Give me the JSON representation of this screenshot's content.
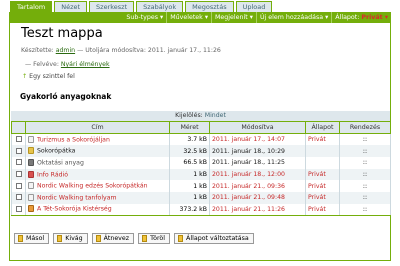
{
  "tabs": [
    "Tartalom",
    "Nézet",
    "Szerkeszt",
    "Szabályok",
    "Megosztás",
    "Upload"
  ],
  "actions": {
    "subtypes": "Sub-types ▾",
    "muveletek": "Műveletek ▾",
    "megjelenit": "Megjelenít ▾",
    "uj_elem": "Új elem hozzáadása ▾",
    "allapot_label": "Állapot:",
    "allapot_value": "Privát ▾"
  },
  "page": {
    "title": "Teszt mappa",
    "byline_prefix": "Készítette:",
    "author": "admin",
    "byline_suffix": "— Utoljára módosítva: 2011. január 17., 11:26",
    "attached_prefix": "— Felvéve:",
    "attached_link": "Nyári élmények",
    "up_arrow": "↑",
    "up_label": "Egy szinttel fel",
    "description": "Gyakorló anyagoknak"
  },
  "table": {
    "selection_label": "Kijelölés:",
    "selection_link": "Mindet",
    "headers": [
      "Cím",
      "Méret",
      "Módosítva",
      "Állapot",
      "Rendezés"
    ],
    "rows": [
      {
        "icon": "page-icon",
        "title": "Turizmus a Sokorójáljan",
        "size": "3.7 kB",
        "modified": "2011. január 17., 14:07",
        "state": "Privát",
        "order": "::"
      },
      {
        "icon": "folder-icon",
        "title": "Sokorópátka",
        "size": "32.5 kB",
        "modified": "2011. január 18., 10:29",
        "state": "",
        "order": "::"
      },
      {
        "icon": "link-icon",
        "title": "Oktatási anyag",
        "size": "66.5 kB",
        "modified": "2011. január 18., 11:25",
        "state": "",
        "order": "::"
      },
      {
        "icon": "news-icon",
        "title": "Info Rádió",
        "size": "1 kB",
        "modified": "2011. január 18., 12:00",
        "state": "Privát",
        "order": "::"
      },
      {
        "icon": "page-icon",
        "title": "Nordic Walking edzés Sokorópátkán",
        "size": "1 kB",
        "modified": "2011. január 21., 09:36",
        "state": "Privát",
        "order": "::"
      },
      {
        "icon": "page-icon",
        "title": "Nordic Walking tanfolyam",
        "size": "1 kB",
        "modified": "2011. január 21., 09:48",
        "state": "Privát",
        "order": "::"
      },
      {
        "icon": "file-icon",
        "title": "A Tét-Sokorója Kistérség",
        "size": "373.2 kB",
        "modified": "2011. január 21., 11:26",
        "state": "Privát",
        "order": "::"
      }
    ]
  },
  "buttons": [
    "Másol",
    "Kivág",
    "Átnevez",
    "Töröl",
    "Állapot változtatása"
  ],
  "colors": {
    "accent": "#74ae0b",
    "tab_bg": "#dee7ec",
    "private": "#c62828"
  }
}
